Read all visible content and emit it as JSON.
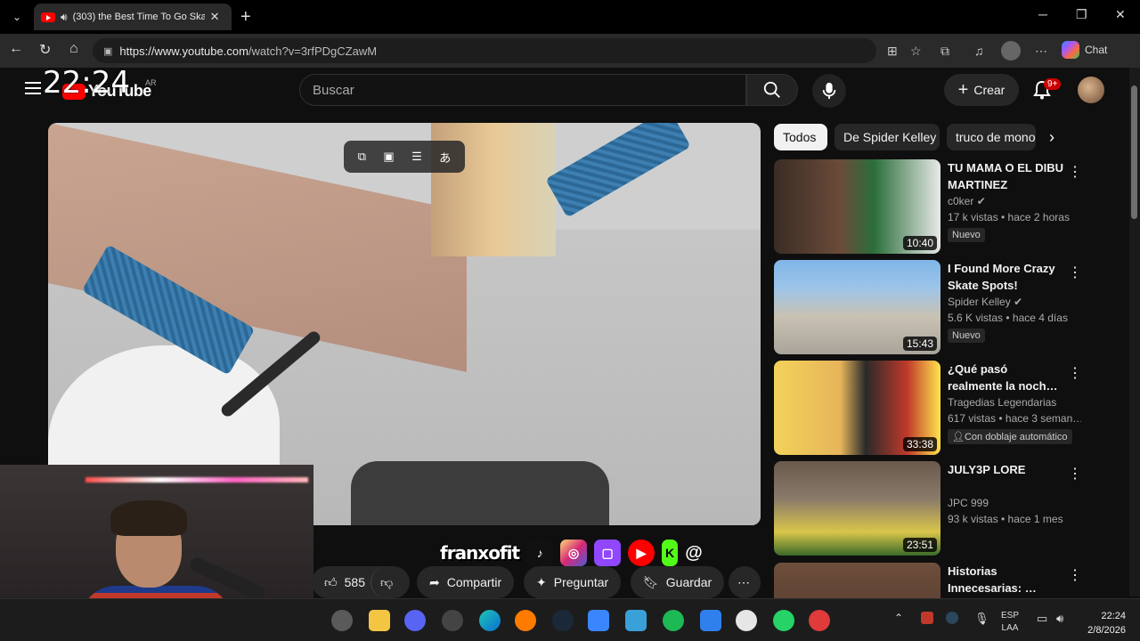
{
  "browser": {
    "tab_title": "(303) the Best Time To Go Skat",
    "url_host": "https://www.youtube.com",
    "url_path": "/watch?v=3rfPDgCZawM",
    "copilot_label": "Chat"
  },
  "overlay_clock": "22:24",
  "youtube": {
    "logo_text": "YouTube",
    "country": "AR",
    "search_placeholder": "Buscar",
    "create_label": "Crear",
    "notification_badge": "9+"
  },
  "actions": {
    "likes": "585",
    "share": "Compartir",
    "ask": "Preguntar",
    "save": "Guardar"
  },
  "social_overlay": {
    "name": "franxofit"
  },
  "chips": [
    "Todos",
    "De Spider Kelley",
    "truco de mono"
  ],
  "recommendations": [
    {
      "title": "TU MAMA O EL DIBU MARTINEZ",
      "channel": "c0ker",
      "meta": "17 k vistas • hace 2 horas",
      "badge": "Nuevo",
      "duration": "10:40"
    },
    {
      "title": "I Found More Crazy Skate Spots!",
      "channel": "Spider Kelley",
      "meta": "5.6 K vistas • hace 4 días",
      "badge": "Nuevo",
      "duration": "15:43"
    },
    {
      "title": "¿Qué pasó realmente la noch…",
      "channel": "Tragedias Legendarias",
      "meta": "617 vistas • hace 3 seman…",
      "badge": "Con doblaje automático",
      "duration": "33:38"
    },
    {
      "title": "JULY3P LORE",
      "channel": "JPC 999",
      "meta": "93 k vistas • hace 1 mes",
      "badge": "",
      "duration": "23:51"
    },
    {
      "title": "Historias Innecesarias: …",
      "channel": "",
      "meta": "",
      "badge": "",
      "duration": ""
    }
  ],
  "taskbar": {
    "lang_top": "ESP",
    "lang_bottom": "LAA",
    "time": "22:24",
    "date": "2/8/2026"
  }
}
